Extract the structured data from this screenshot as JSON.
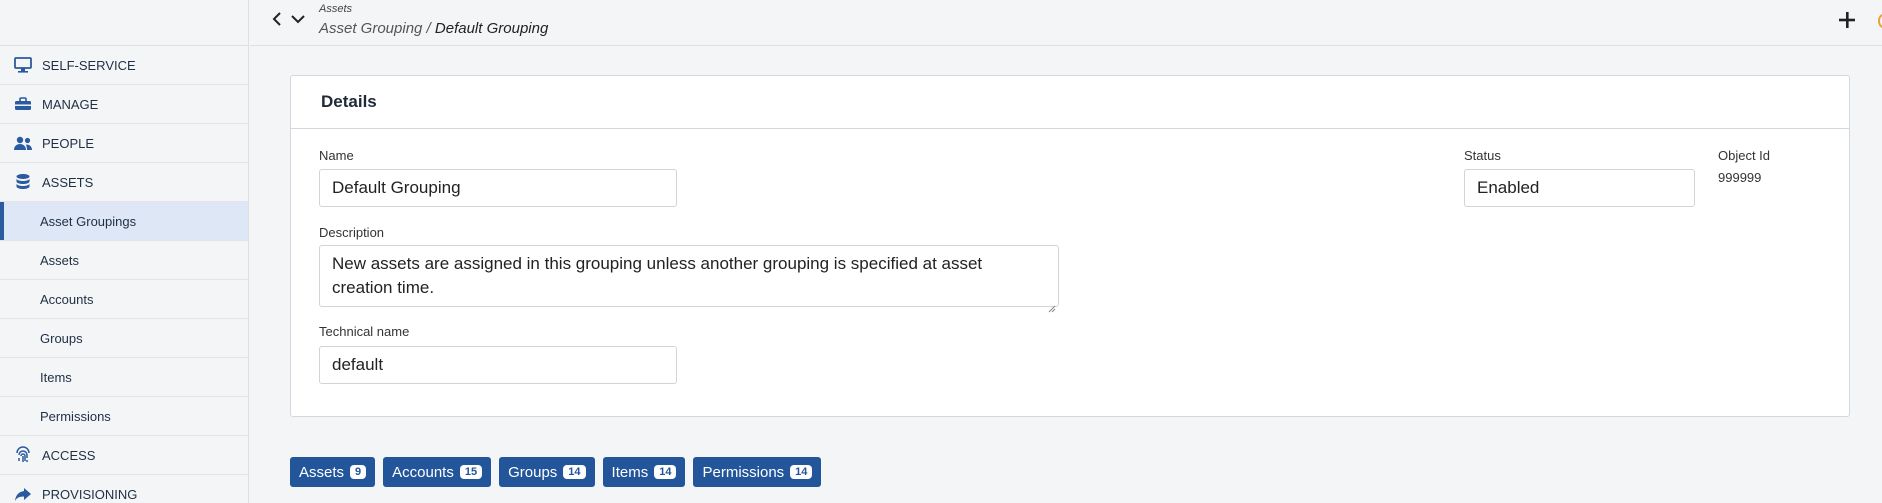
{
  "sidebar": {
    "sections": [
      {
        "label": "SELF-SERVICE",
        "icon": "monitor-icon"
      },
      {
        "label": "MANAGE",
        "icon": "toolbox-icon"
      },
      {
        "label": "PEOPLE",
        "icon": "people-icon"
      },
      {
        "label": "ASSETS",
        "icon": "database-icon"
      }
    ],
    "sub_items": [
      {
        "label": "Asset Groupings",
        "active": true
      },
      {
        "label": "Assets"
      },
      {
        "label": "Accounts"
      },
      {
        "label": "Groups"
      },
      {
        "label": "Items"
      },
      {
        "label": "Permissions"
      }
    ],
    "bottom_sections": [
      {
        "label": "ACCESS",
        "icon": "fingerprint-icon"
      },
      {
        "label": "PROVISIONING",
        "icon": "share-arrow-icon"
      }
    ]
  },
  "header": {
    "breadcrumb_parent": "Assets",
    "breadcrumb_path": "Asset Grouping",
    "breadcrumb_separator": " / ",
    "breadcrumb_current": "Default Grouping"
  },
  "details": {
    "title": "Details",
    "name_label": "Name",
    "name_value": "Default Grouping",
    "status_label": "Status",
    "status_value": "Enabled",
    "object_id_label": "Object Id",
    "object_id_value": "999999",
    "description_label": "Description",
    "description_value": "New assets are assigned in this grouping unless another grouping is specified at asset creation time.",
    "technical_name_label": "Technical name",
    "technical_name_value": "default"
  },
  "tabs": [
    {
      "label": "Assets",
      "count": "9"
    },
    {
      "label": "Accounts",
      "count": "15"
    },
    {
      "label": "Groups",
      "count": "14"
    },
    {
      "label": "Items",
      "count": "14"
    },
    {
      "label": "Permissions",
      "count": "14"
    }
  ],
  "colors": {
    "accent": "#22559a",
    "active_bg": "#dde7f5"
  }
}
